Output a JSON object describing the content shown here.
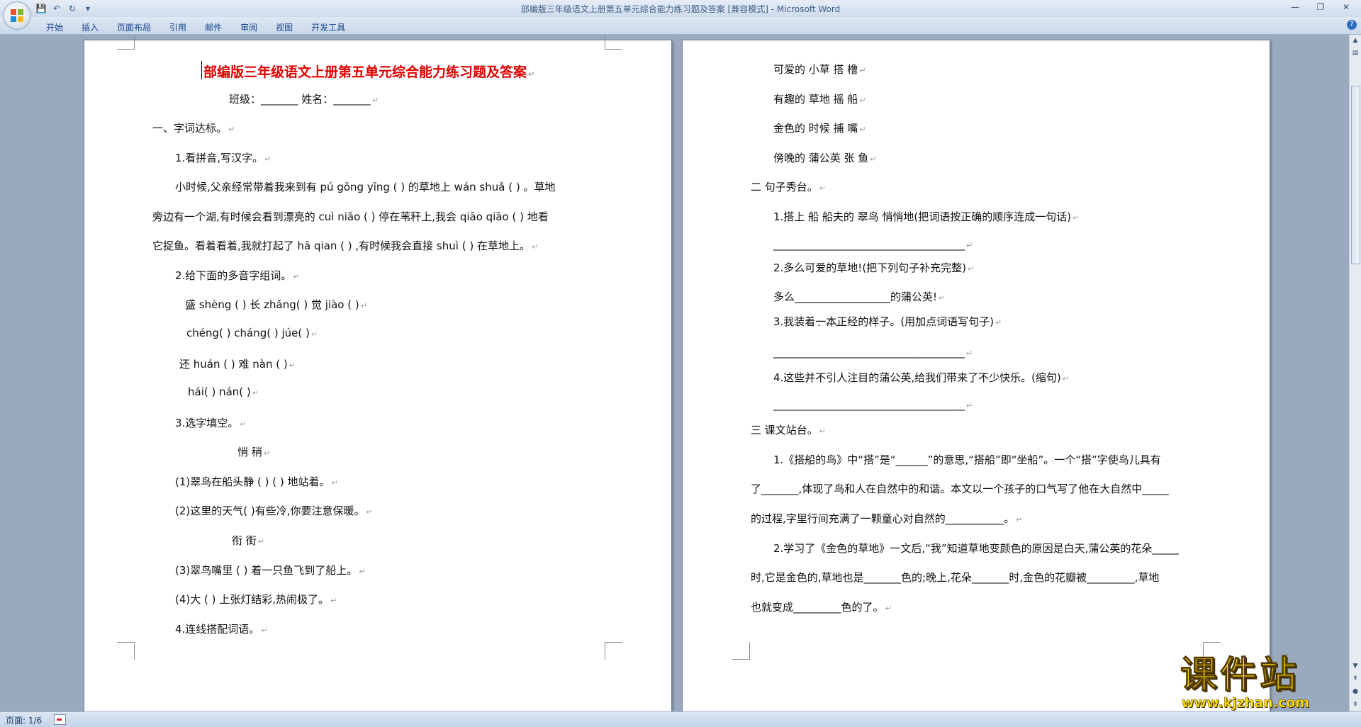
{
  "window": {
    "title": "部编版三年级语文上册第五单元综合能力练习题及答案 [兼容模式] - Microsoft Word"
  },
  "quick_access": [
    {
      "icon": "save-icon",
      "glyph": "💾"
    },
    {
      "icon": "undo-icon",
      "glyph": "↶"
    },
    {
      "icon": "redo-icon",
      "glyph": "↻"
    },
    {
      "icon": "customize-qat-icon",
      "glyph": "▾"
    }
  ],
  "window_controls": {
    "minimize": "—",
    "maximize": "❐",
    "close": "✕"
  },
  "ribbon_tabs": [
    "开始",
    "插入",
    "页面布局",
    "引用",
    "邮件",
    "审阅",
    "视图",
    "开发工具"
  ],
  "paragraph_mark": "↵",
  "page1": {
    "title": "部编版三年级语文上册第五单元综合能力练习题及答案",
    "lines": [
      "班级：_______   姓名：_______",
      "一、字词达标。",
      "1.看拼音,写汉字。",
      "小时候,父亲经常带着我来到有 pú gōng yīng (       ) 的草地上 wán shuǎ (       ) 。草地",
      "旁边有一个湖,有时候会看到漂亮的 cuì niǎo (       ) 停在苇秆上,我会 qiāo qiāo (       ) 地看",
      "它捉鱼。看着看着,我就打起了 hā qian (        ) ,有时候我会直接 shuì (       ) 在草地上。",
      "2.给下面的多音字组词。",
      "盛 shèng (      )     长 zhǎng(     )   觉 jiào  (   )",
      "chéng(     )      cháng(     )      júe(     )",
      "还 huán (      )     难 nàn (      )",
      "hái(      )          nán(     )",
      "3.选字填空。",
      "悄        稍",
      "(1)翠鸟在船头静 (     ) (      ) 地站着。",
      "(2)这里的天气(    )有些冷,你要注意保暖。",
      "衔        街",
      "(3)翠鸟嘴里 (     ) 着一只鱼飞到了船上。",
      "(4)大 (      ) 上张灯结彩,热闹极了。",
      "4.连线搭配词语。"
    ]
  },
  "page2": {
    "lines": [
      "可爱的            小草                  搭            橹",
      "有趣的            草地                    摇          船",
      "金色的            时候                    捕          嘴",
      "傍晚的            蒲公英                张          鱼",
      "二    句子秀台。",
      "1.搭上    船    船夫的     翠鸟    悄悄地(把词语按正确的顺序连成一句话)",
      "____________________________________",
      "2.多么可爱的草地!(把下列句子补充完整)",
      "多么__________________的蒲公英!",
      "3.我装着一本正经的样子。(用加点词语写句子)",
      "____________________________________",
      "4.这些并不引人注目的蒲公英,给我们带来了不少快乐。(缩句)",
      "____________________________________",
      "三    课文站台。",
      "1.《搭船的鸟》中“搭”是“______”的意思,“搭船”即“坐船”。一个“搭”字使鸟儿具有",
      "了_______,体现了鸟和人在自然中的和谐。本文以一个孩子的口气写了他在大自然中_____",
      "的过程,字里行间充满了一颗童心对自然的___________。",
      "2.学习了《金色的草地》一文后,“我”知道草地变颜色的原因是白天,蒲公英的花朵_____",
      "时,它是金色的,草地也是_______色的;晚上,花朵_______时,金色的花瓣被_________,草地",
      "也就变成_________色的了。"
    ]
  },
  "status": {
    "page_counter": "页面: 1/6"
  },
  "watermark": {
    "cn": "课件站",
    "url": "www.kjzhan.com"
  }
}
